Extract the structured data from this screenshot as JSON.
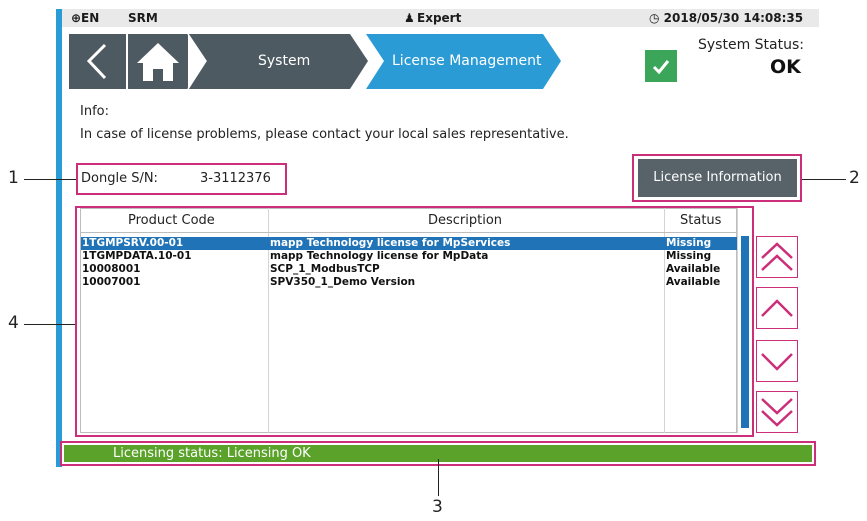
{
  "topbar": {
    "language": "⊕EN",
    "app": "SRM",
    "user": "Expert",
    "datetime": "◷ 2018/05/30 14:08:35"
  },
  "breadcrumb": {
    "items": [
      "System",
      "License Management"
    ]
  },
  "system_status": {
    "title": "System Status:",
    "value": "OK"
  },
  "info": {
    "label": "Info:",
    "text": "In case of license problems, please contact your local sales representative."
  },
  "dongle": {
    "label": "Dongle S/N:",
    "value": "3-3112376"
  },
  "license_button": "License Information",
  "table": {
    "headers": [
      "Product Code",
      "Description",
      "Status"
    ],
    "rows": [
      {
        "code": "1TGMPSRV.00-01",
        "description": "mapp Technology license for MpServices",
        "status": "Missing"
      },
      {
        "code": "1TGMPDATA.10-01",
        "description": "mapp Technology license for MpData",
        "status": "Missing"
      },
      {
        "code": "10008001",
        "description": "SCP_1_ModbusTCP",
        "status": "Available"
      },
      {
        "code": "10007001",
        "description": "SPV350_1_Demo Version",
        "status": "Available"
      }
    ]
  },
  "footer": {
    "status_text": "Licensing status: Licensing OK"
  },
  "callouts": [
    "1",
    "2",
    "3",
    "4"
  ],
  "colors": {
    "accent_blue": "#1f73b6",
    "nav_gray": "#4e5a62",
    "status_green": "#5aa22a",
    "highlight": "#cc2f7a"
  },
  "icons": [
    "globe-icon",
    "user-icon",
    "clock-icon",
    "back-arrow-icon",
    "home-icon",
    "check-icon",
    "double-chevron-up-icon",
    "chevron-up-icon",
    "chevron-down-icon",
    "double-chevron-down-icon"
  ]
}
